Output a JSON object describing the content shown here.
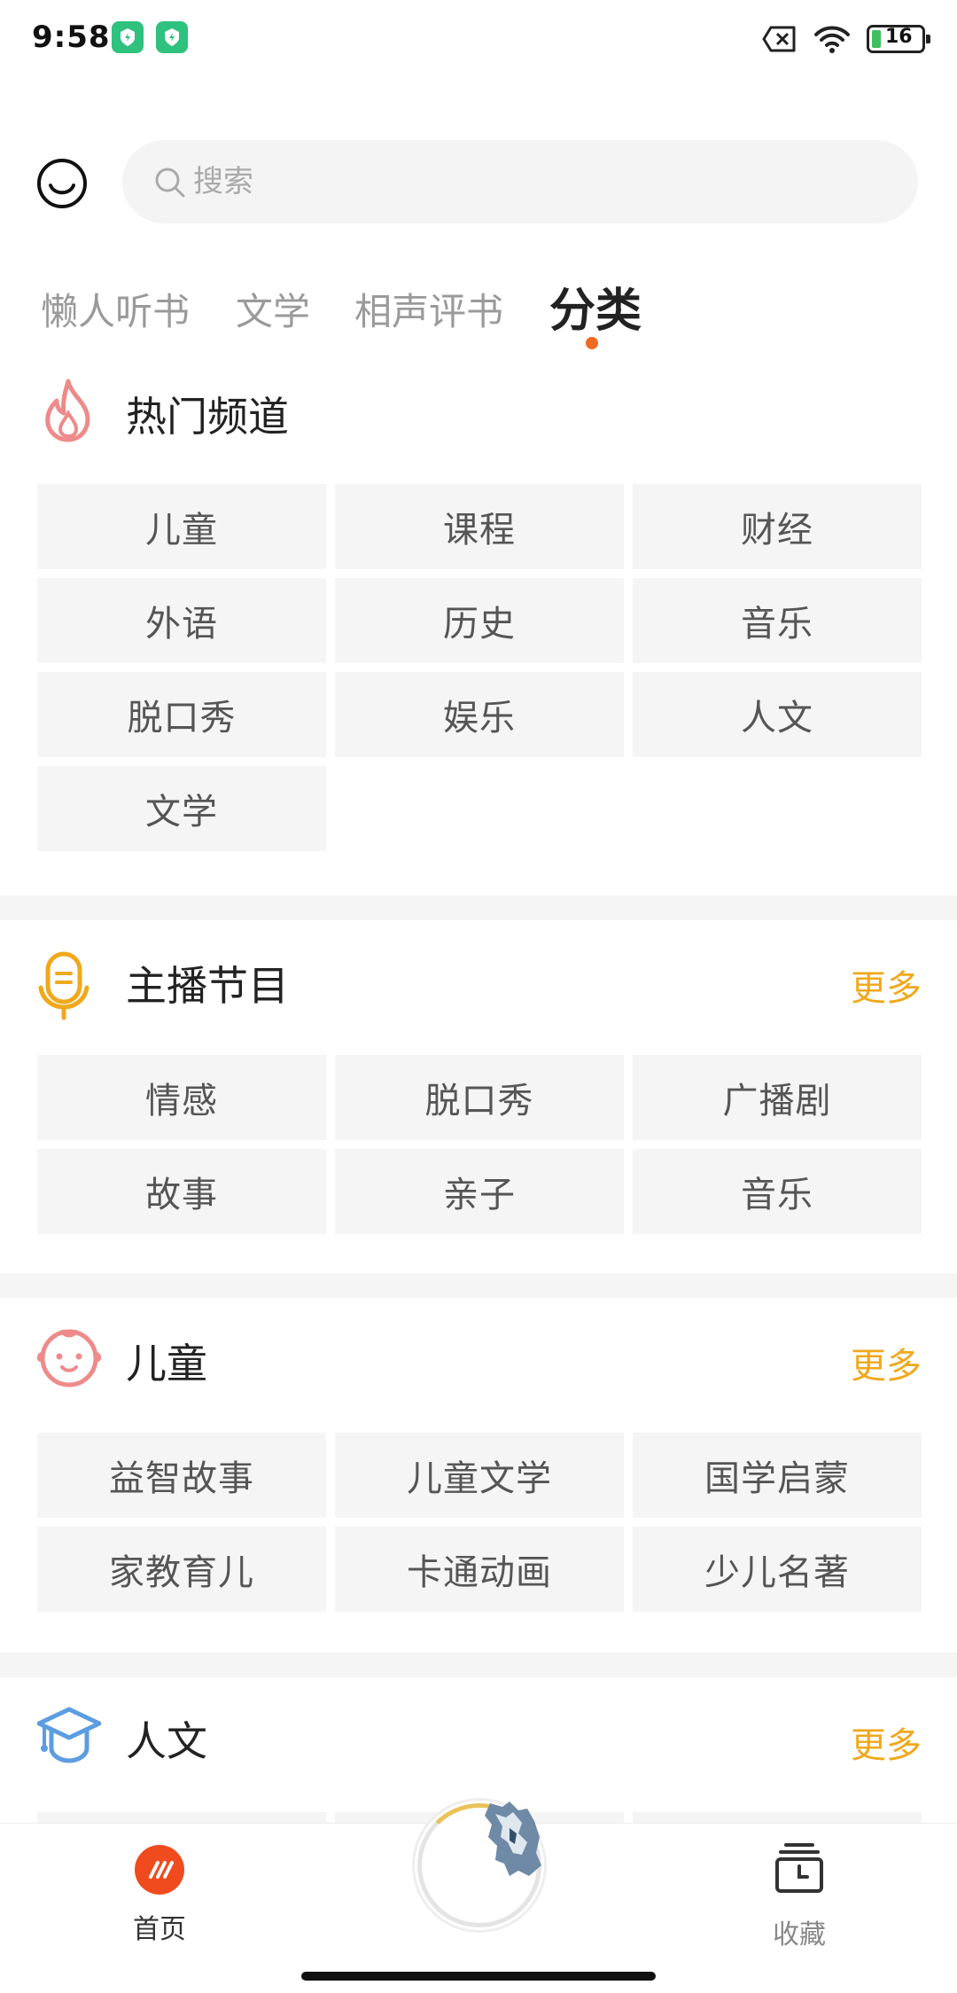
{
  "status_bar": {
    "time": "9:58",
    "battery": "16"
  },
  "search": {
    "placeholder": "搜索"
  },
  "tabs": [
    {
      "label": "懒人听书",
      "active": false
    },
    {
      "label": "文学",
      "active": false
    },
    {
      "label": "相声评书",
      "active": false
    },
    {
      "label": "分类",
      "active": true
    }
  ],
  "sections": {
    "hot": {
      "title": "热门频道",
      "items": [
        "儿童",
        "课程",
        "财经",
        "外语",
        "历史",
        "音乐",
        "脱口秀",
        "娱乐",
        "人文",
        "文学"
      ]
    },
    "host": {
      "title": "主播节目",
      "more": "更多",
      "items": [
        "情感",
        "脱口秀",
        "广播剧",
        "故事",
        "亲子",
        "音乐"
      ]
    },
    "kids": {
      "title": "儿童",
      "more": "更多",
      "items": [
        "益智故事",
        "儿童文学",
        "国学启蒙",
        "家教育儿",
        "卡通动画",
        "少儿名著"
      ]
    },
    "humanities": {
      "title": "人文",
      "more": "更多"
    }
  },
  "bottom_nav": {
    "home": "首页",
    "favorites": "收藏"
  },
  "colors": {
    "accent": "#f06a22",
    "more": "#f0a81c",
    "home_icon": "#ef4b1f"
  }
}
